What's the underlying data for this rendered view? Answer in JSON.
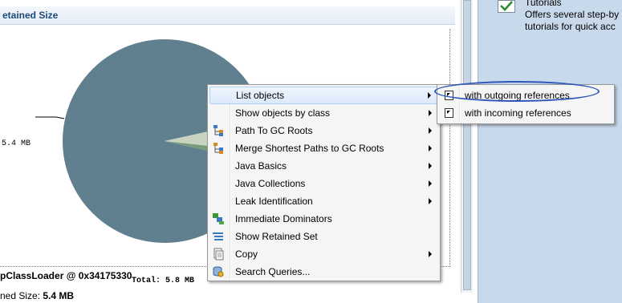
{
  "panel": {
    "title": "etained Size"
  },
  "chart_data": {
    "type": "pie",
    "slices": [
      {
        "value": 5.4,
        "color": "#61808f"
      },
      {
        "value": 0.3,
        "color": "#c8d4c0"
      },
      {
        "value": 0.1,
        "color": "#7a9a78"
      }
    ],
    "labels": [
      "5.4 MB"
    ],
    "total_label": "Total: 5.8 MB"
  },
  "object": {
    "name": "pClassLoader @ 0x34175330",
    "retained_prefix": "ned Size: ",
    "retained_value": "5.4 MB"
  },
  "right_panel": {
    "title": "Tutorials",
    "description_line1": "Offers several step-by",
    "description_line2": "tutorials for quick acc"
  },
  "context_menu": {
    "items": [
      {
        "label": "List objects",
        "icon": "none",
        "submenu": true,
        "highlighted": true
      },
      {
        "label": "Show objects by class",
        "icon": "none",
        "submenu": true
      },
      {
        "label": "Path To GC Roots",
        "icon": "tree-icon",
        "submenu": true
      },
      {
        "label": "Merge Shortest Paths to GC Roots",
        "icon": "merge-tree-icon",
        "submenu": true
      },
      {
        "label": "Java Basics",
        "icon": "none",
        "submenu": true
      },
      {
        "label": "Java Collections",
        "icon": "none",
        "submenu": true
      },
      {
        "label": "Leak Identification",
        "icon": "none",
        "submenu": true
      },
      {
        "label": "Immediate Dominators",
        "icon": "dominators-icon",
        "submenu": false
      },
      {
        "label": "Show Retained Set",
        "icon": "list-icon",
        "submenu": false
      },
      {
        "label": "Copy",
        "icon": "copy-icon",
        "submenu": true
      },
      {
        "label": "Search Queries...",
        "icon": "search-queries-icon",
        "submenu": false
      }
    ]
  },
  "submenu": {
    "items": [
      {
        "label": "with outgoing references",
        "icon": "outgoing-icon"
      },
      {
        "label": "with incoming references",
        "icon": "incoming-icon"
      }
    ]
  },
  "colors": {
    "pie_main": "#61808f",
    "menu_highlight": "#dceafb",
    "annotation": "#2f56b8"
  }
}
